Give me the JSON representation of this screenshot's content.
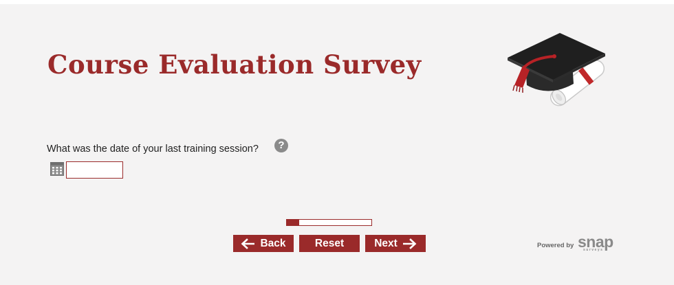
{
  "header": {
    "title": "Course Evaluation Survey",
    "logo_icon": "graduation-cap-diploma-icon"
  },
  "question": {
    "text": "What was the date of your last training session?",
    "help_icon": "question-mark-icon",
    "help_glyph": "?",
    "calendar_icon": "calendar-icon",
    "date_value": "",
    "date_placeholder": ""
  },
  "progress": {
    "fraction": 0.15
  },
  "navigation": {
    "back_label": "Back",
    "reset_label": "Reset",
    "next_label": "Next"
  },
  "footer": {
    "powered_by": "Powered by",
    "brand": "snap",
    "brand_sub": "surveys"
  },
  "colors": {
    "accent": "#9a2a2a",
    "background": "#f4f3f3",
    "text": "#222222",
    "icon_gray": "#8a8a8a"
  }
}
